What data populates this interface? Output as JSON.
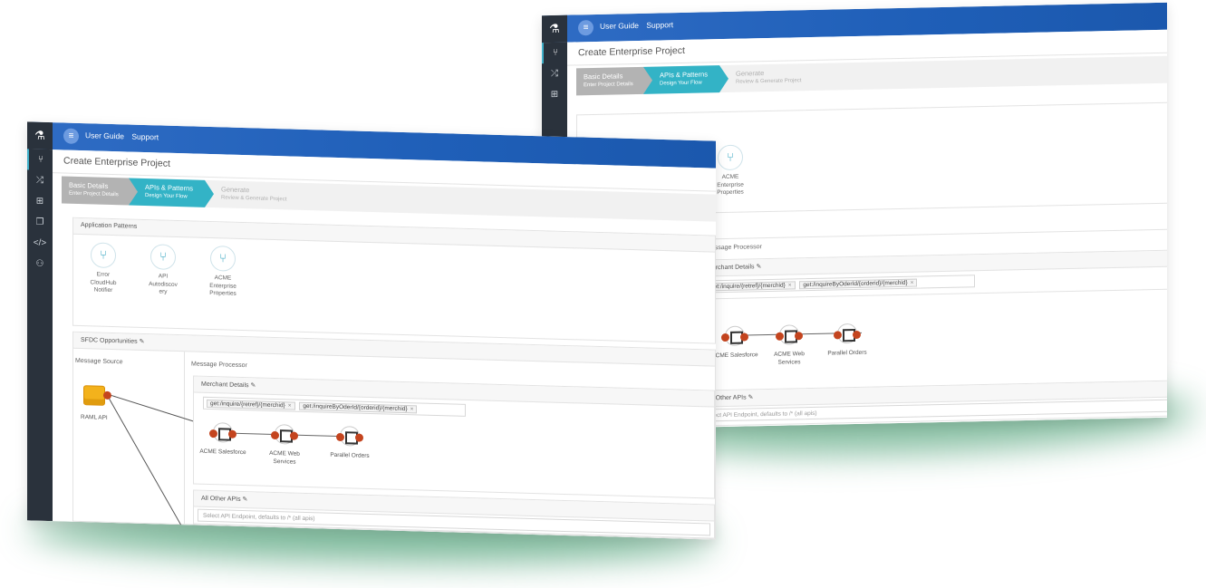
{
  "app": {
    "logo_icon": "flask-icon",
    "menu_icon": "menu-icon",
    "links": [
      "User Guide",
      "Support"
    ],
    "page_title": "Create Enterprise Project"
  },
  "nav_icons": [
    "git-icon",
    "shuffle-icon",
    "sitemap-icon",
    "copy-icon",
    "code-icon",
    "user-plus-icon"
  ],
  "wizard": {
    "steps": [
      {
        "title": "Basic Details",
        "subtitle": "Enter Project Details",
        "state": "done"
      },
      {
        "title": "APIs & Patterns",
        "subtitle": "Design Your Flow",
        "state": "active"
      },
      {
        "title": "Generate",
        "subtitle": "Review & Generate Project",
        "state": "pending"
      }
    ]
  },
  "application_patterns": {
    "heading": "Application Patterns",
    "items": [
      "Error CloudHub Notifier",
      "API Autodiscov ery",
      "ACME Enterprise Properties"
    ]
  },
  "flow": {
    "heading": "SFDC Opportunities",
    "source_label": "Message Source",
    "processor_label": "Message Processor",
    "source": "RAML API",
    "merchant_heading": "Merchant Details",
    "endpoints": [
      "get:/inquire/{retref}/{merchid}",
      "get:/inquireByOderId/{orderid}/{merchid}"
    ],
    "nodes": [
      "ACME Salesforce",
      "ACME Web Services",
      "Parallel Orders"
    ],
    "other_heading": "All Other APIs",
    "other_placeholder": "Select API Endpoint, defaults to /* (all apis)"
  },
  "colors": {
    "topbar": "#1f5fb8",
    "sidenav": "#2a323c",
    "active_step": "#33b3c6",
    "node_dot": "#c4441e",
    "glow": "#288c5a"
  }
}
